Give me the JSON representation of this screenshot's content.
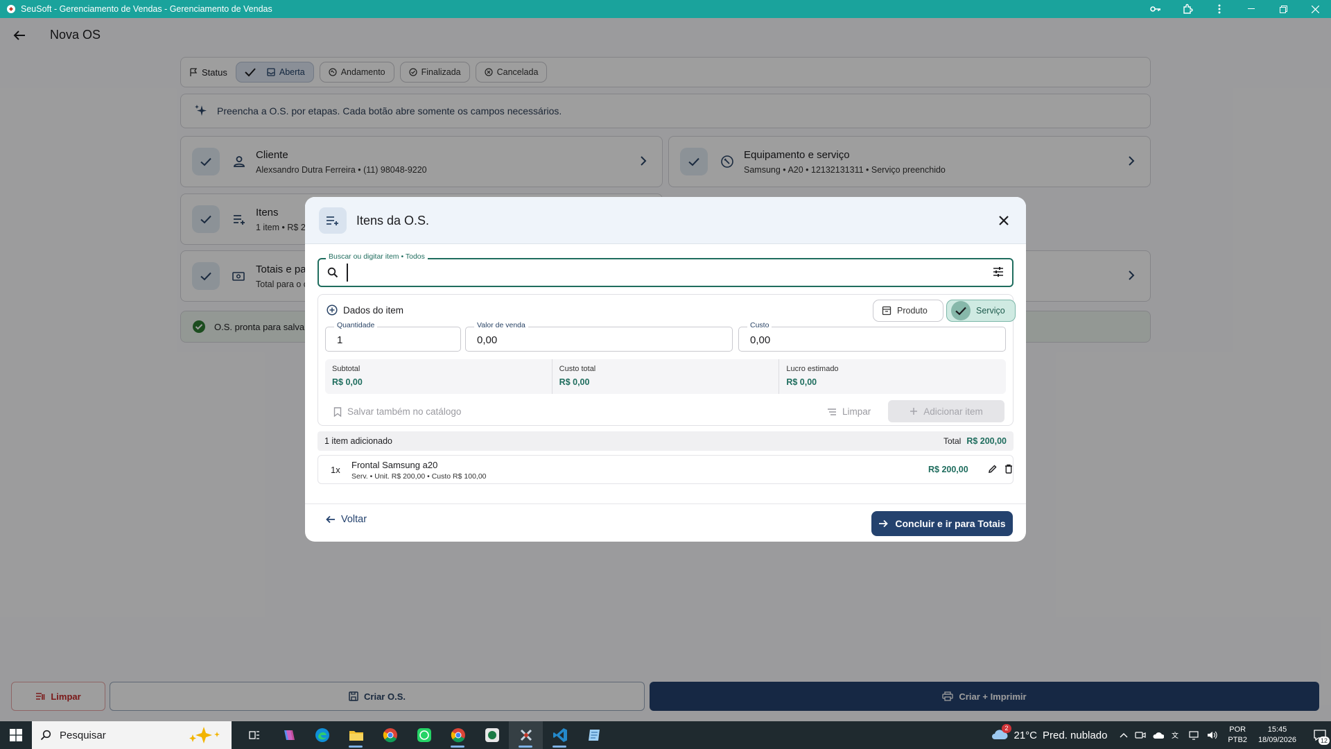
{
  "window": {
    "title": "SeuSoft - Gerenciamento de Vendas - Gerenciamento de Vendas"
  },
  "header": {
    "title": "Nova OS"
  },
  "status": {
    "label": "Status",
    "chips": [
      {
        "label": "Aberta",
        "active": true
      },
      {
        "label": "Andamento",
        "active": false
      },
      {
        "label": "Finalizada",
        "active": false
      },
      {
        "label": "Cancelada",
        "active": false
      }
    ]
  },
  "info_text": "Preencha a O.S. por etapas. Cada botão abre somente os campos necessários.",
  "steps": {
    "cliente": {
      "title": "Cliente",
      "subtitle": "Alexsandro Dutra Ferreira • (11) 98048-9220"
    },
    "equipamento": {
      "title": "Equipamento e serviço",
      "subtitle": "Samsung • A20 • 12132131311 • Serviço preenchido"
    },
    "itens": {
      "title": "Itens",
      "subtitle": "1 item • R$ 2"
    },
    "totais": {
      "title": "Totais e pa",
      "subtitle": "Total para o c"
    }
  },
  "ready_text": "O.S. pronta para salva",
  "bottom": {
    "limpar": "Limpar",
    "criar": "Criar O.S.",
    "criar_imprimir": "Criar + Imprimir"
  },
  "modal": {
    "title": "Itens da O.S.",
    "search": {
      "label": "Buscar ou digitar item • Todos",
      "value": ""
    },
    "dados": {
      "title": "Dados do item",
      "type_produto": "Produto",
      "type_servico": "Serviço",
      "selected_type": "Serviço",
      "quantidade_label": "Quantidade",
      "quantidade_value": "1",
      "valor_label": "Valor de venda",
      "valor_value": "0,00",
      "custo_label": "Custo",
      "custo_value": "0,00",
      "subtotal_label": "Subtotal",
      "subtotal_value": "R$ 0,00",
      "custo_total_label": "Custo total",
      "custo_total_value": "R$ 0,00",
      "lucro_label": "Lucro estimado",
      "lucro_value": "R$ 0,00",
      "salvar_catalogo": "Salvar também no catálogo",
      "limpar": "Limpar",
      "adicionar": "Adicionar item"
    },
    "list": {
      "count_text": "1 item adicionado",
      "total_label": "Total",
      "total_value": "R$ 200,00",
      "items": [
        {
          "qty": "1x",
          "name": "Frontal Samsung a20",
          "meta": "Serv. • Unit. R$ 200,00 • Custo R$ 100,00",
          "price": "R$ 200,00"
        }
      ]
    },
    "footer": {
      "voltar": "Voltar",
      "concluir": "Concluir e ir para Totais"
    }
  },
  "taskbar": {
    "search_placeholder": "Pesquisar",
    "weather_temp": "21°C",
    "weather_desc": "Pred. nublado",
    "weather_badge": "2",
    "lang_line1": "POR",
    "lang_line2": "PTB2",
    "time": "15:45",
    "date": "18/09/2026",
    "notif_count": "12"
  },
  "colors": {
    "titlebar": "#1aa39c",
    "primary": "#24426e",
    "accent_green": "#1f6d5e",
    "danger": "#c62828"
  }
}
